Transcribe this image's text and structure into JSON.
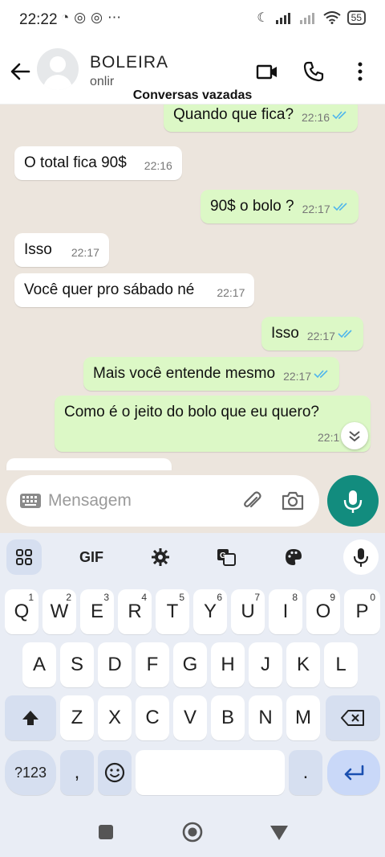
{
  "status_bar": {
    "time": "22:22",
    "battery": "55"
  },
  "header": {
    "contact_name": "BOLEIRA",
    "contact_status": "onlir"
  },
  "overlay_caption": "Conversas vazadas",
  "messages": [
    {
      "dir": "out",
      "text": "Quando que fica?",
      "time": "22:16",
      "ticks": true
    },
    {
      "dir": "in",
      "text": "O total fica 90$",
      "time": "22:16"
    },
    {
      "dir": "out",
      "text": "90$ o bolo ?",
      "time": "22:17",
      "ticks": true
    },
    {
      "dir": "in",
      "text": "Isso",
      "time": "22:17"
    },
    {
      "dir": "in",
      "text": "Você quer pro sábado né",
      "time": "22:17"
    },
    {
      "dir": "out",
      "text": "Isso",
      "time": "22:17",
      "ticks": true
    },
    {
      "dir": "out",
      "text": "Mais você entende mesmo",
      "time": "22:17",
      "ticks": true
    },
    {
      "dir": "out",
      "text": "Como é o jeito do bolo que eu quero?",
      "time": "22:1",
      "ticks": false
    }
  ],
  "composer": {
    "placeholder": "Mensagem"
  },
  "keyboard": {
    "toolbar": {
      "gif": "GIF"
    },
    "row1": [
      {
        "k": "Q",
        "n": "1"
      },
      {
        "k": "W",
        "n": "2"
      },
      {
        "k": "E",
        "n": "3"
      },
      {
        "k": "R",
        "n": "4"
      },
      {
        "k": "T",
        "n": "5"
      },
      {
        "k": "Y",
        "n": "6"
      },
      {
        "k": "U",
        "n": "7"
      },
      {
        "k": "I",
        "n": "8"
      },
      {
        "k": "O",
        "n": "9"
      },
      {
        "k": "P",
        "n": "0"
      }
    ],
    "row2": [
      "A",
      "S",
      "D",
      "F",
      "G",
      "H",
      "J",
      "K",
      "L"
    ],
    "row3": [
      "Z",
      "X",
      "C",
      "V",
      "B",
      "N",
      "M"
    ],
    "symbols_label": "?123",
    "comma": ",",
    "period": "."
  },
  "colors": {
    "chat_bg": "#ece5dd",
    "incoming": "#ffffff",
    "outgoing": "#dcf8c6",
    "mic": "#128c7e",
    "read_ticks": "#4fb6ec"
  }
}
